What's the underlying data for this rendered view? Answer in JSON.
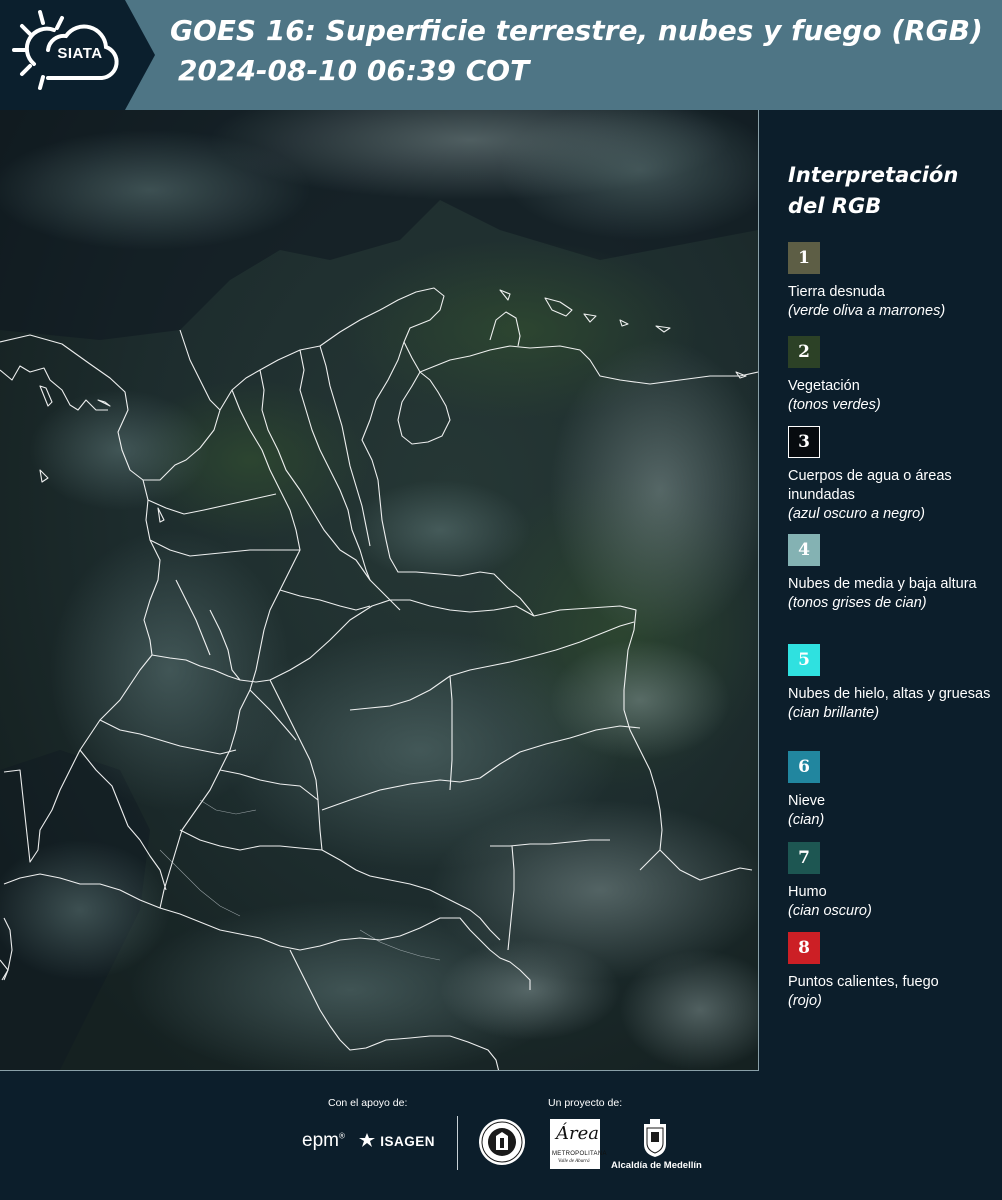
{
  "header": {
    "logo_text": "SIATA",
    "title_line1": "GOES 16: Superficie terrestre, nubes y fuego (RGB)",
    "title_line2": "2024-08-10 06:39 COT"
  },
  "map": {
    "icon": "satellite-rgb-map",
    "colors": {
      "background": "#16232b",
      "boundaries": "#ffffff"
    }
  },
  "legend": {
    "title": "Interpretación del RGB",
    "items": [
      {
        "num": "1",
        "name": "Tierra desnuda",
        "desc": "(verde oliva a marrones)",
        "color": "#5d5e45"
      },
      {
        "num": "2",
        "name": "Vegetación",
        "desc": "(tonos verdes)",
        "color": "#2c4126"
      },
      {
        "num": "3",
        "name": "Cuerpos de agua o áreas inundadas",
        "desc": "(azul oscuro a negro)",
        "color": "#070b0f"
      },
      {
        "num": "4",
        "name": "Nubes de media y baja altura",
        "desc": "(tonos grises de cian)",
        "color": "#84b2b3"
      },
      {
        "num": "5",
        "name": "Nubes de hielo, altas y gruesas",
        "desc": "(cian brillante)",
        "color": "#2fe1e0"
      },
      {
        "num": "6",
        "name": "Nieve",
        "desc": "(cian)",
        "color": "#21869f"
      },
      {
        "num": "7",
        "name": "Humo",
        "desc": "(cian oscuro)",
        "color": "#1d5652"
      },
      {
        "num": "8",
        "name": "Puntos calientes, fuego",
        "desc": "(rojo)",
        "color": "#cc1f25"
      }
    ]
  },
  "footer": {
    "support_label": "Con el apoyo de:",
    "project_label": "Un proyecto de:",
    "sponsor_1": "epm",
    "sponsor_1_mark": "®",
    "sponsor_2": "ISAGEN",
    "partner_1_script": "Área",
    "partner_1_name": "METROPOLITANA",
    "partner_1_sub": "Valle de Aburrá",
    "partner_2": "Alcaldía de Medellín",
    "icons": {
      "seal": "university-seal-icon",
      "crest": "medellin-crest-icon"
    }
  }
}
